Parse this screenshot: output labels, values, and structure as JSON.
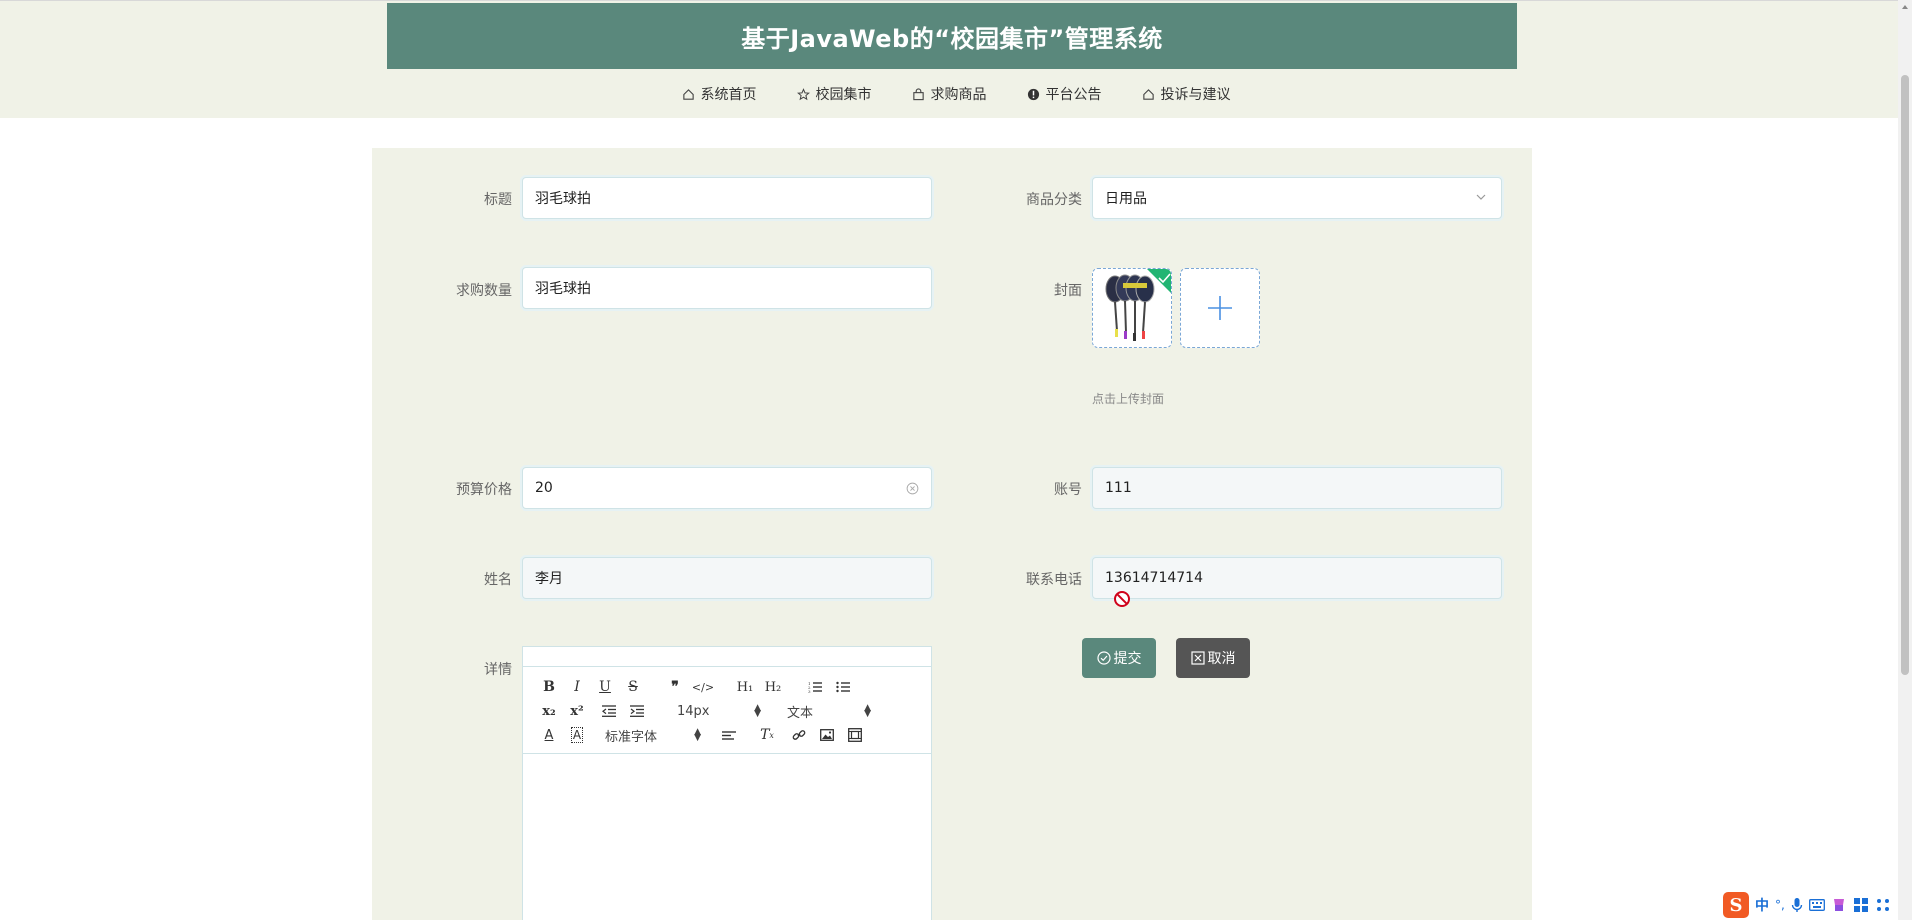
{
  "header": {
    "title": "基于JavaWeb的“校园集市”管理系统"
  },
  "nav": {
    "items": [
      {
        "label": "系统首页",
        "icon": "home-icon"
      },
      {
        "label": "校园集市",
        "icon": "star-icon"
      },
      {
        "label": "求购商品",
        "icon": "bag-icon"
      },
      {
        "label": "平台公告",
        "icon": "info-icon"
      },
      {
        "label": "投诉与建议",
        "icon": "home-icon"
      }
    ]
  },
  "form": {
    "title_label": "标题",
    "title_value": "羽毛球拍",
    "category_label": "商品分类",
    "category_value": "日用品",
    "quantity_label": "求购数量",
    "quantity_value": "羽毛球拍",
    "cover_label": "封面",
    "cover_hint": "点击上传封面",
    "price_label": "预算价格",
    "price_value": "20",
    "account_label": "账号",
    "account_value": "111",
    "name_label": "姓名",
    "name_value": "李月",
    "phone_label": "联系电话",
    "phone_value": "13614714714",
    "detail_label": "详情",
    "submit_label": "提交",
    "cancel_label": "取消"
  },
  "editor": {
    "font_size": "14px",
    "text_type": "文本",
    "font_family": "标准字体"
  },
  "ime": {
    "lang": "中"
  },
  "colors": {
    "title_bg": "#5a887c",
    "band_bg": "#f0f2e7",
    "submit_bg": "#5a887c",
    "cancel_bg": "#555555"
  }
}
